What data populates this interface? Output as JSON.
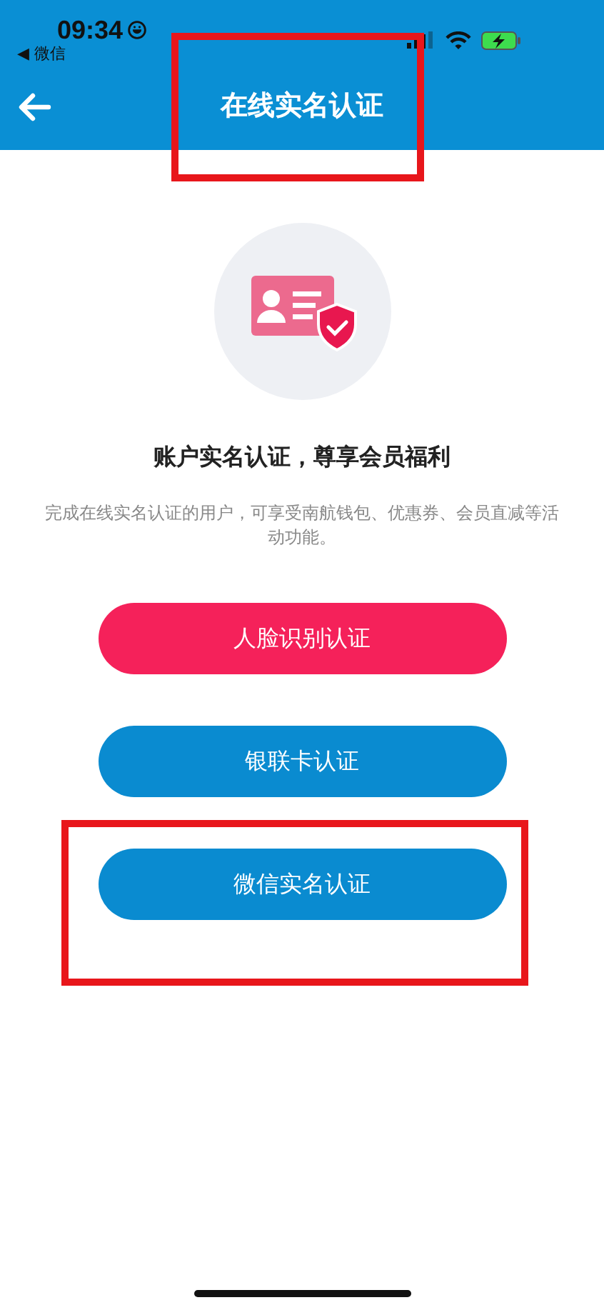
{
  "status_bar": {
    "time": "09:34",
    "back_app": "◀ 微信"
  },
  "nav": {
    "title": "在线实名认证",
    "highlighted": true
  },
  "heading": "账户实名认证，尊享会员福利",
  "description": "完成在线实名认证的用户，可享受南航钱包、优惠券、会员直减等活动功能。",
  "buttons": [
    {
      "label": "人脸识别认证",
      "kind": "primary",
      "highlighted": false
    },
    {
      "label": "银联卡认证",
      "kind": "secondary",
      "highlighted": false
    },
    {
      "label": "微信实名认证",
      "kind": "secondary",
      "highlighted": true
    }
  ]
}
